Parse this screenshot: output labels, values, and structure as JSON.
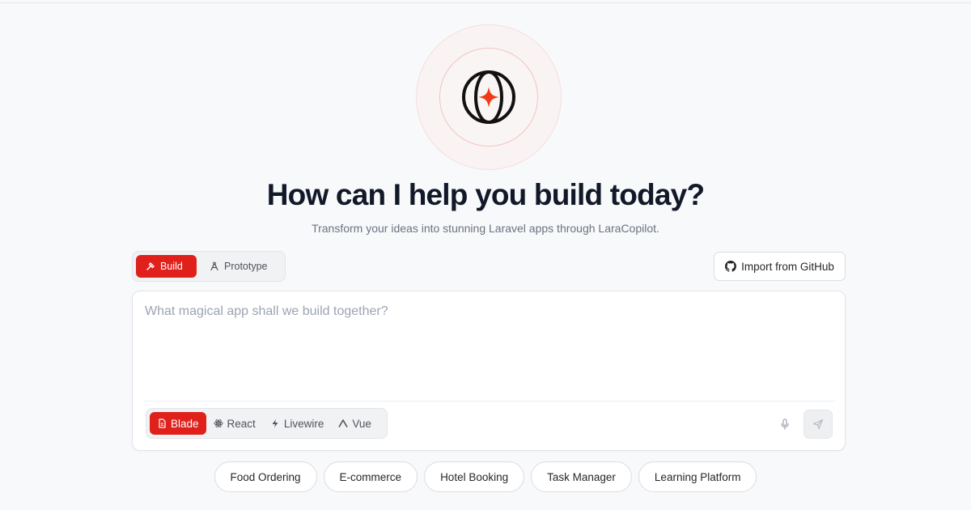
{
  "hero": {
    "title": "How can I help you build today?",
    "subtitle": "Transform your ideas into stunning Laravel apps through LaraCopilot.",
    "logo_icon": "globe-sparkle-icon"
  },
  "mode": {
    "options": [
      {
        "label": "Build",
        "icon": "hammer-icon",
        "active": true
      },
      {
        "label": "Prototype",
        "icon": "drafting-compass-icon",
        "active": false
      }
    ]
  },
  "github": {
    "label": "Import from GitHub",
    "icon": "github-icon"
  },
  "prompt": {
    "placeholder": "What magical app shall we build together?",
    "value": ""
  },
  "frameworks": {
    "options": [
      {
        "label": "Blade",
        "icon": "file-icon",
        "active": true
      },
      {
        "label": "React",
        "icon": "atom-icon",
        "active": false
      },
      {
        "label": "Livewire",
        "icon": "bolt-icon",
        "active": false
      },
      {
        "label": "Vue",
        "icon": "vue-icon",
        "active": false
      }
    ]
  },
  "actions": {
    "mic_icon": "microphone-icon",
    "send_icon": "send-icon"
  },
  "suggestions": [
    "Food Ordering",
    "E-commerce",
    "Hotel Booking",
    "Task Manager",
    "Learning Platform"
  ],
  "colors": {
    "accent": "#e0211b",
    "logo_star": "#f03a17",
    "background": "#f8f9fb"
  }
}
